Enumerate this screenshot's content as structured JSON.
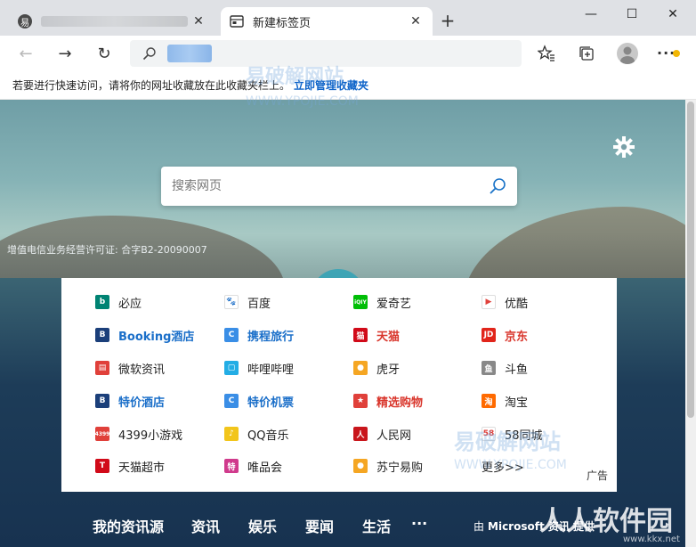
{
  "tabs": [
    {
      "title": "",
      "favicon_text": "易",
      "close": "✕"
    },
    {
      "title": "新建标签页",
      "close": "✕"
    }
  ],
  "new_tab_symbol": "+",
  "window_controls": {
    "minimize": "—",
    "maximize": "☐",
    "close": "✕"
  },
  "nav": {
    "back": "←",
    "forward": "→",
    "refresh": "↻"
  },
  "more_label": "···",
  "favorites_hint": {
    "text": "若要进行快速访问，请将你的网址收藏放在此收藏夹栏上。",
    "link": "立即管理收藏夹"
  },
  "search": {
    "placeholder": "搜索网页"
  },
  "license": "增值电信业务经营许可证: 合字B2-20090007",
  "quick_links": [
    {
      "label": "必应",
      "icon": "bing-icon",
      "icon_text": "b",
      "icon_color": "#008373",
      "style": ""
    },
    {
      "label": "百度",
      "icon": "baidu-paw-icon",
      "icon_text": "🐾",
      "icon_color": "#ffffff",
      "style": ""
    },
    {
      "label": "爱奇艺",
      "icon": "iqiyi-icon",
      "icon_text": "iQIY",
      "icon_color": "#00be06",
      "style": ""
    },
    {
      "label": "优酷",
      "icon": "youku-icon",
      "icon_text": "▶",
      "icon_color": "#ffffff",
      "style": ""
    },
    {
      "label": "Booking酒店",
      "icon": "booking-icon",
      "icon_text": "B",
      "icon_color": "#1b3f7a",
      "style": "blue"
    },
    {
      "label": "携程旅行",
      "icon": "ctrip-icon",
      "icon_text": "C",
      "icon_color": "#3a8ee6",
      "style": "blue"
    },
    {
      "label": "天猫",
      "icon": "tmall-icon",
      "icon_text": "猫",
      "icon_color": "#d10a19",
      "style": "red"
    },
    {
      "label": "京东",
      "icon": "jd-icon",
      "icon_text": "JD",
      "icon_color": "#e1251b",
      "style": "red"
    },
    {
      "label": "微软资讯",
      "icon": "msn-news-icon",
      "icon_text": "▤",
      "icon_color": "#e0403a",
      "style": ""
    },
    {
      "label": "哔哩哔哩",
      "icon": "bilibili-icon",
      "icon_text": "▢",
      "icon_color": "#23ade5",
      "style": ""
    },
    {
      "label": "虎牙",
      "icon": "huya-icon",
      "icon_text": "●",
      "icon_color": "#f5a623",
      "style": ""
    },
    {
      "label": "斗鱼",
      "icon": "douyu-icon",
      "icon_text": "鱼",
      "icon_color": "#888888",
      "style": ""
    },
    {
      "label": "特价酒店",
      "icon": "booking-icon",
      "icon_text": "B",
      "icon_color": "#1b3f7a",
      "style": "blue"
    },
    {
      "label": "特价机票",
      "icon": "ctrip-icon",
      "icon_text": "C",
      "icon_color": "#3a8ee6",
      "style": "blue"
    },
    {
      "label": "精选购物",
      "icon": "shopping-icon",
      "icon_text": "★",
      "icon_color": "#e0403a",
      "style": "red"
    },
    {
      "label": "淘宝",
      "icon": "taobao-icon",
      "icon_text": "淘",
      "icon_color": "#ff6a00",
      "style": ""
    },
    {
      "label": "4399小游戏",
      "icon": "4399-icon",
      "icon_text": "4399",
      "icon_color": "#e0403a",
      "style": ""
    },
    {
      "label": "QQ音乐",
      "icon": "qqmusic-icon",
      "icon_text": "♪",
      "icon_color": "#f2c51b",
      "style": ""
    },
    {
      "label": "人民网",
      "icon": "people-icon",
      "icon_text": "人",
      "icon_color": "#c9161c",
      "style": ""
    },
    {
      "label": "58同城",
      "icon": "58-icon",
      "icon_text": "58",
      "icon_color": "#ffffff",
      "style": ""
    },
    {
      "label": "天猫超市",
      "icon": "tmall-market-icon",
      "icon_text": "T",
      "icon_color": "#d10a19",
      "style": ""
    },
    {
      "label": "唯品会",
      "icon": "vip-icon",
      "icon_text": "特",
      "icon_color": "#d03a8c",
      "style": ""
    },
    {
      "label": "苏宁易购",
      "icon": "suning-icon",
      "icon_text": "●",
      "icon_color": "#f5a623",
      "style": ""
    },
    {
      "label": "更多>>",
      "icon": "",
      "icon_text": "",
      "icon_color": "",
      "style": ""
    }
  ],
  "ad_label": "广告",
  "bottom_nav": [
    "我的资讯源",
    "资讯",
    "娱乐",
    "要闻",
    "生活",
    "···"
  ],
  "credit": {
    "pre": "由",
    "text": "Microsoft 资讯 提供"
  },
  "watermarks": {
    "top_cn": "易破解网站",
    "top_en": "WWW.YPOJIE.COM",
    "mid_cn": "易破解网站",
    "mid_en": "WWW.YPOJIE.COM",
    "corner": "人人软件园",
    "corner_url": "www.kkx.net"
  },
  "colors": {
    "accent_link": "#0d63c9",
    "brand_blue": "#1b6fc9",
    "brand_red": "#d9362c"
  }
}
